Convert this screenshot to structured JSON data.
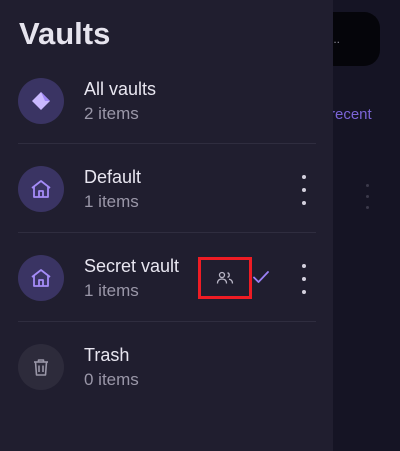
{
  "drawer": {
    "title": "Vaults",
    "vaults": [
      {
        "name": "All vaults",
        "count": "2 items",
        "icon": "diamond-icon"
      },
      {
        "name": "Default",
        "count": "1 items",
        "icon": "home-icon"
      },
      {
        "name": "Secret vault",
        "count": "1 items",
        "icon": "home-icon",
        "shared_icon": "people-icon",
        "selected_icon": "check-icon"
      },
      {
        "name": "Trash",
        "count": "0 items",
        "icon": "trash-icon"
      }
    ]
  },
  "background": {
    "search_hint": "...",
    "sort_label": "recent"
  },
  "colors": {
    "drawer_bg": "#201e2f",
    "accent": "#8f73f2",
    "highlight_box": "#ee1c24"
  }
}
